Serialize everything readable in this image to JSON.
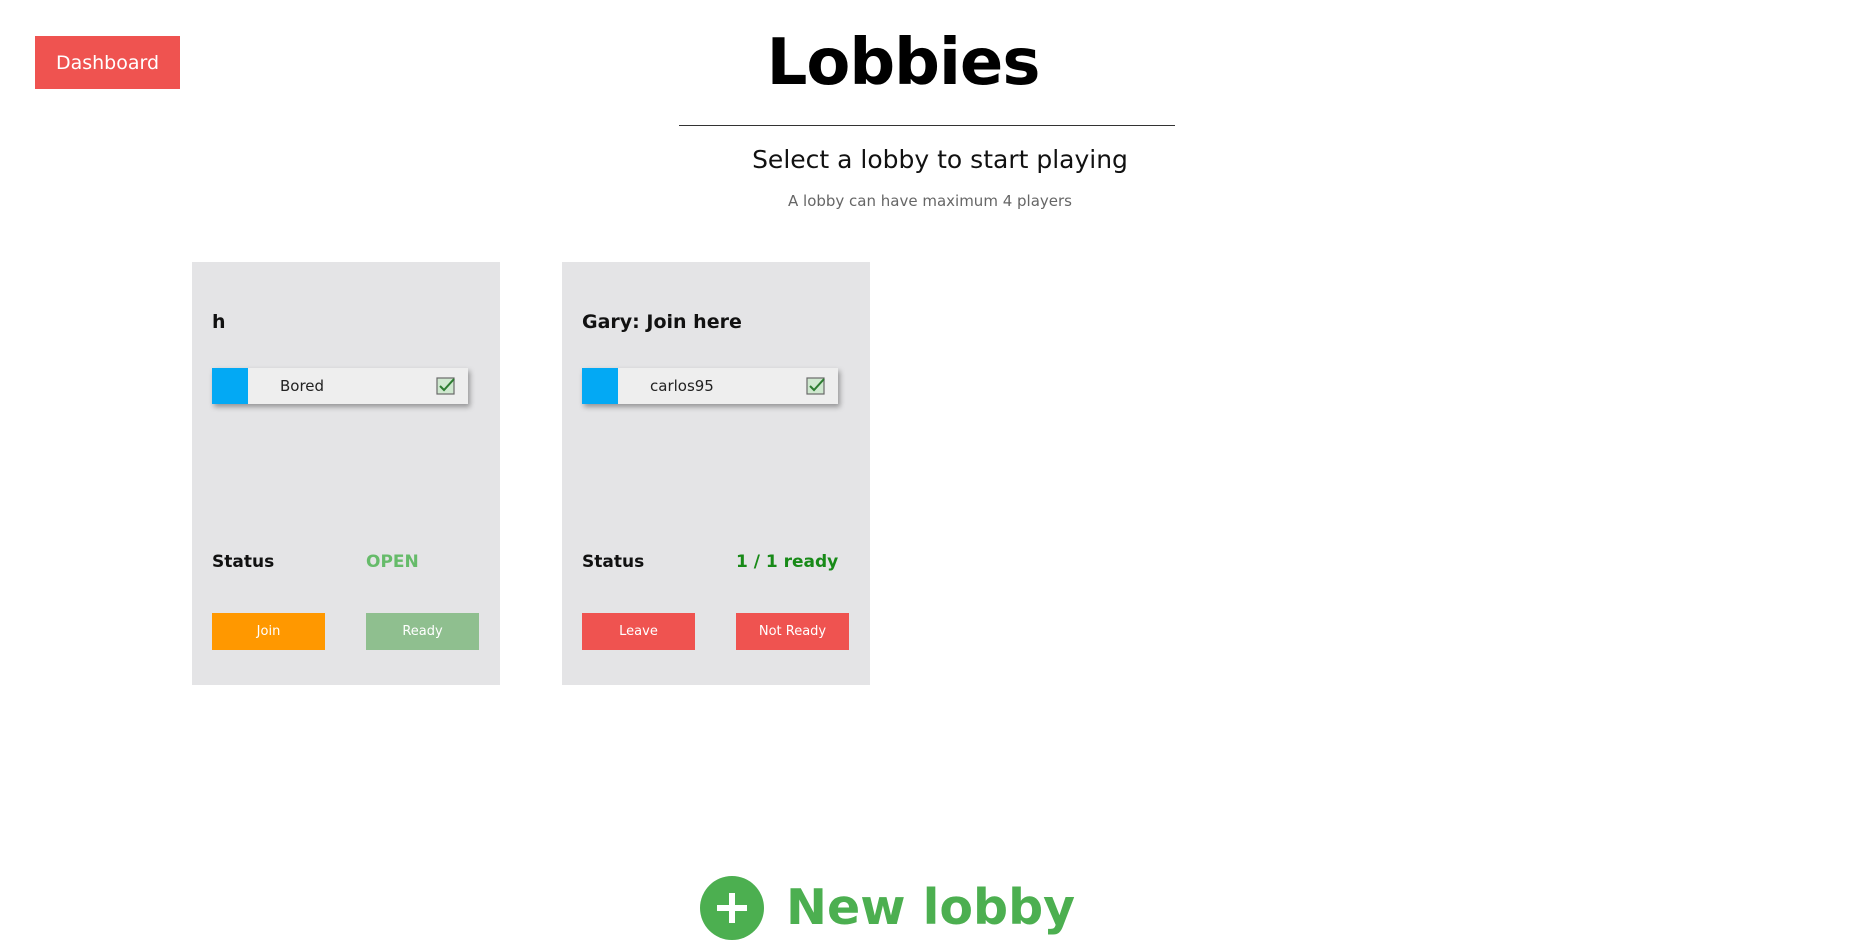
{
  "header": {
    "dashboard_label": "Dashboard",
    "title": "Lobbies",
    "subtitle": "Select a lobby to start playing",
    "caption": "A lobby can have maximum 4 players"
  },
  "lobbies": [
    {
      "name": "h",
      "players": [
        {
          "name": "Bored",
          "color": "#03a9f4",
          "ready": true
        }
      ],
      "status_label": "Status",
      "status_value": "OPEN",
      "buttons": {
        "left": "Join",
        "right": "Ready"
      }
    },
    {
      "name": "Gary: Join here",
      "players": [
        {
          "name": "carlos95",
          "color": "#03a9f4",
          "ready": true
        }
      ],
      "status_label": "Status",
      "status_value": "1 / 1 ready",
      "buttons": {
        "left": "Leave",
        "right": "Not Ready"
      }
    }
  ],
  "new_lobby": {
    "label": "New lobby"
  },
  "colors": {
    "accent_red": "#ef5350",
    "join_orange": "#ff9800",
    "ready_green_muted": "#8fbf8f",
    "new_lobby_green": "#4caf50",
    "player_blue": "#03a9f4"
  }
}
